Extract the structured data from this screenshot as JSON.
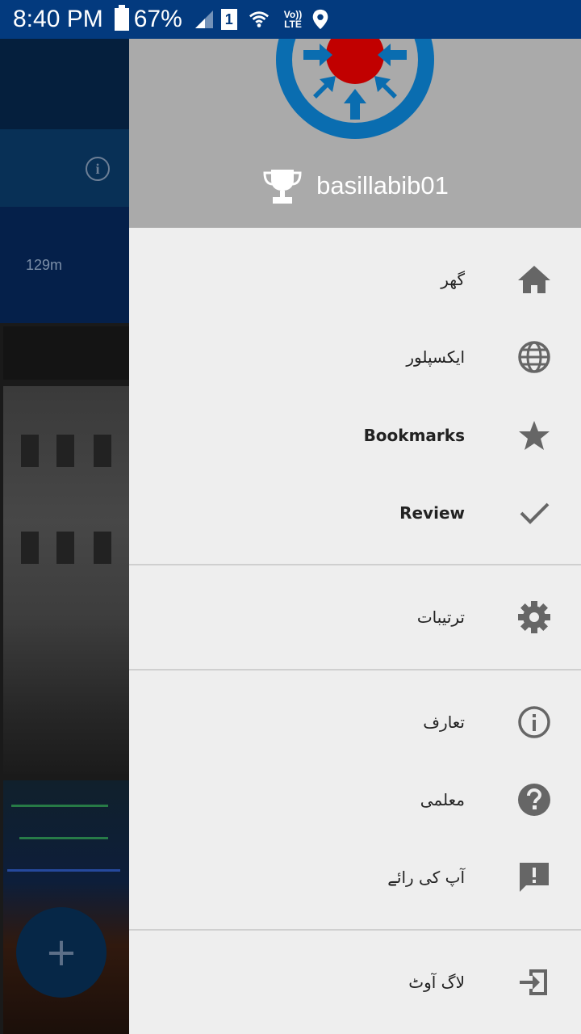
{
  "status_bar": {
    "time": "8:40 PM",
    "battery": "67%",
    "sim_slot": "1",
    "volte_top": "Vo))",
    "volte_bottom": "LTE"
  },
  "background": {
    "distance": "129m",
    "fab_symbol": "+"
  },
  "drawer": {
    "username": "basillabib01",
    "items": [
      {
        "label": "گھر",
        "icon": "home-icon"
      },
      {
        "label": "ایکسپلور",
        "icon": "globe-icon"
      },
      {
        "label": "Bookmarks",
        "icon": "star-icon"
      },
      {
        "label": "Review",
        "icon": "check-icon"
      },
      {
        "label": "ترتیبات",
        "icon": "gear-icon"
      },
      {
        "label": "تعارف",
        "icon": "info-icon"
      },
      {
        "label": "معلمی",
        "icon": "help-icon"
      },
      {
        "label": "آپ کی رائے",
        "icon": "feedback-icon"
      },
      {
        "label": "لاگ آوٹ",
        "icon": "logout-icon"
      }
    ]
  },
  "colors": {
    "status_bar": "#033a7e",
    "drawer_bg": "#eeeeee",
    "header_bg": "#aaaaaa",
    "icon_gray": "#666666",
    "logo_blue": "#0a6db0",
    "logo_red": "#c10000"
  }
}
